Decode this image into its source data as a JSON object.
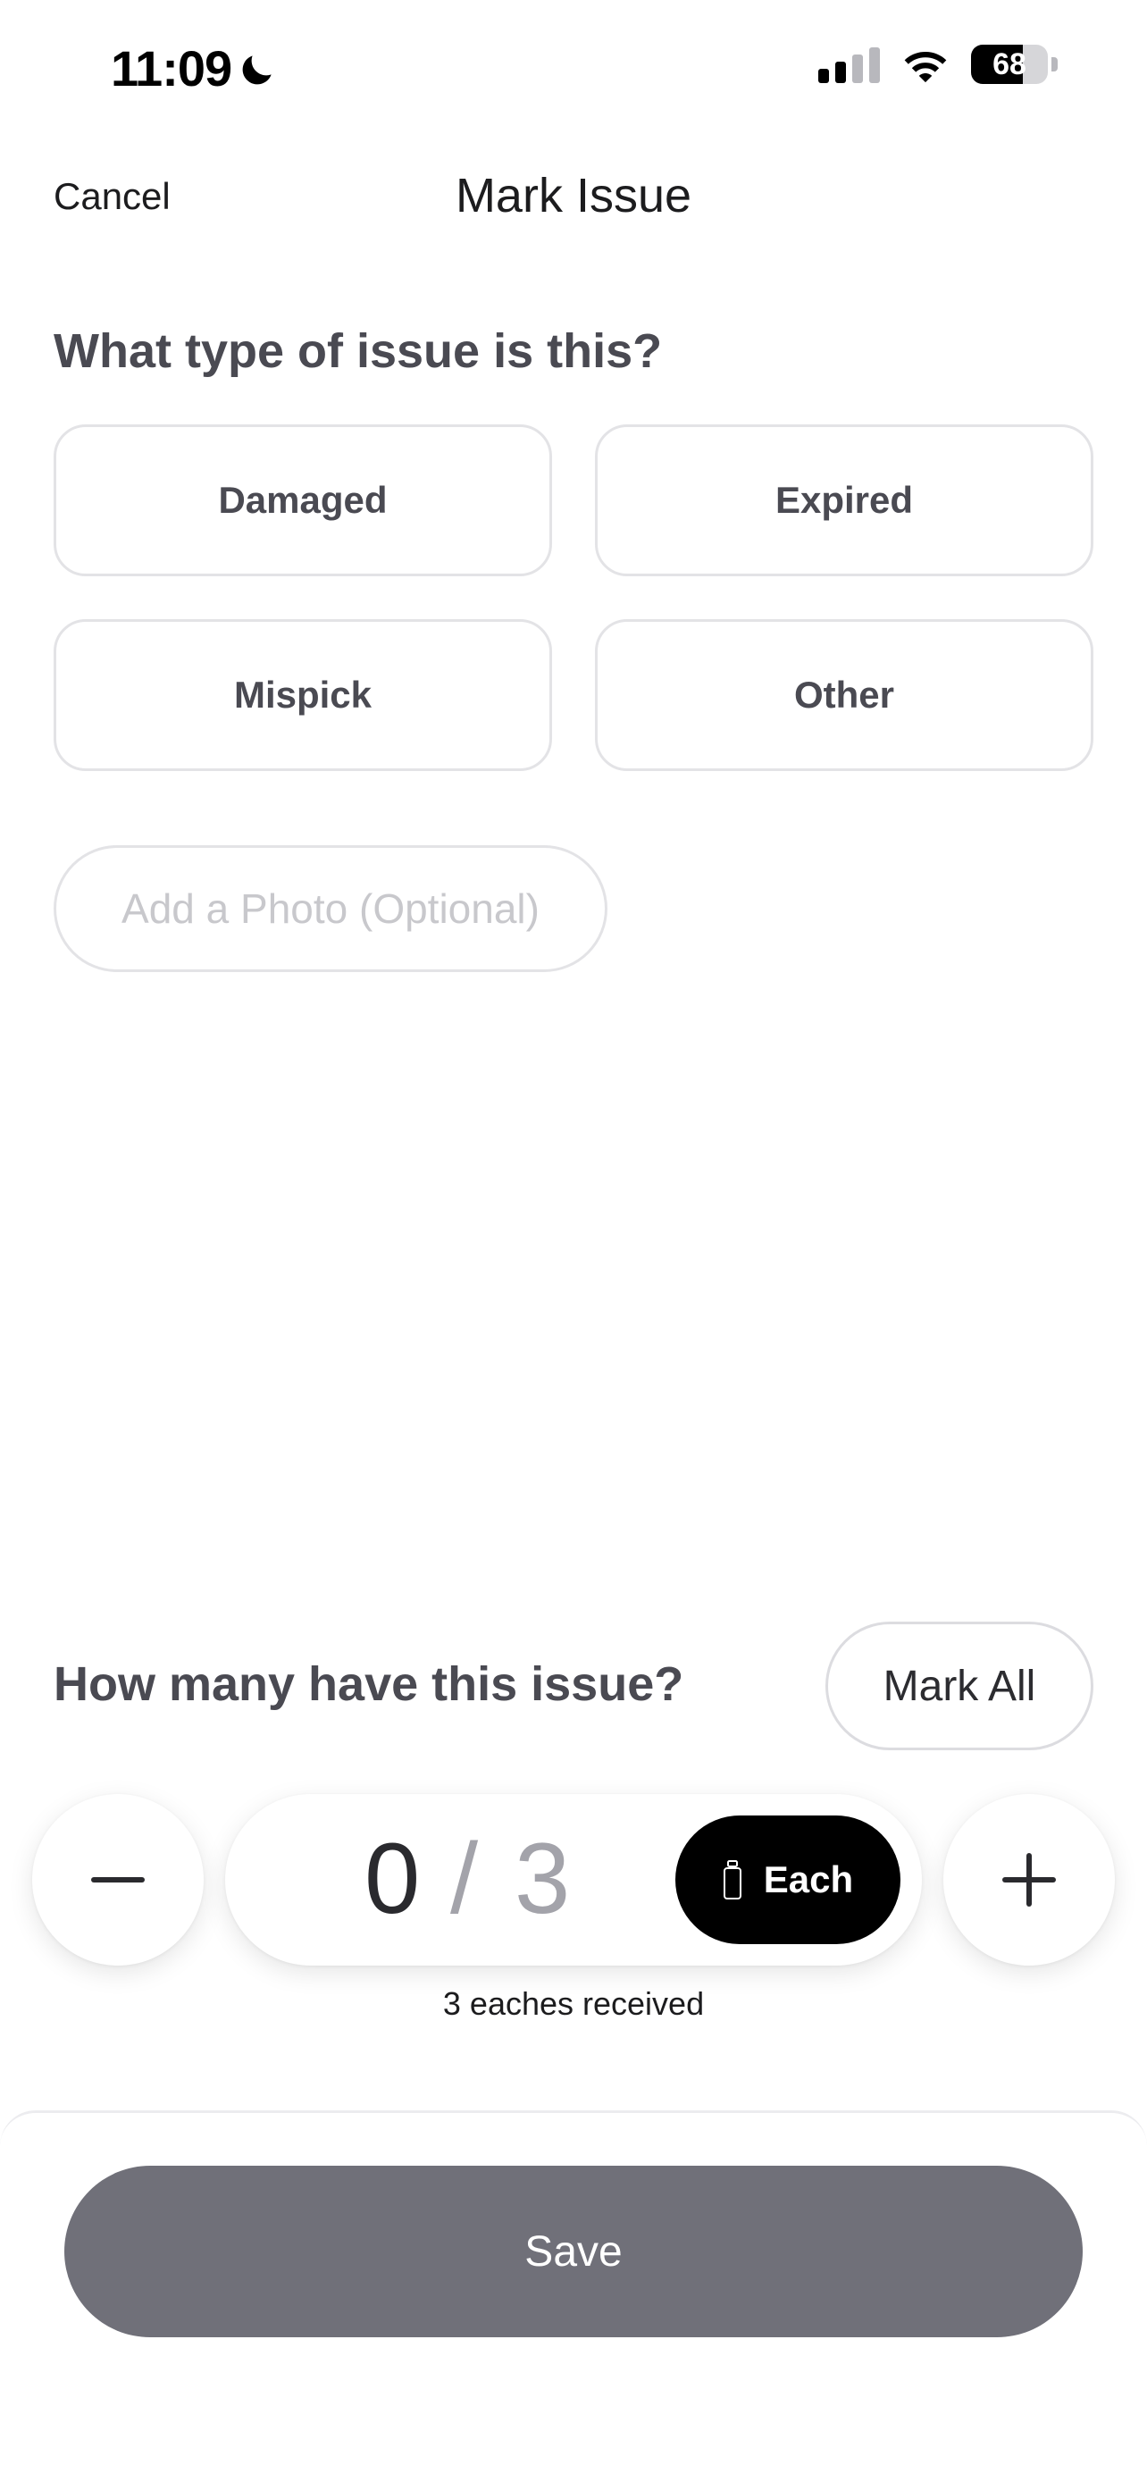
{
  "status_bar": {
    "time": "11:09",
    "battery": "68",
    "battery_level_percent": 68,
    "signal_bars_active": 2,
    "signal_bars_total": 4,
    "icons": [
      "moon-icon",
      "signal-icon",
      "wifi-icon",
      "battery-icon"
    ]
  },
  "nav": {
    "cancel_label": "Cancel",
    "title": "Mark Issue"
  },
  "issue_type": {
    "question": "What type of issue is this?",
    "options": [
      "Damaged",
      "Expired",
      "Mispick",
      "Other"
    ]
  },
  "photo": {
    "label": "Add a Photo (Optional)"
  },
  "quantity": {
    "question": "How many have this issue?",
    "mark_all_label": "Mark All",
    "current": "0",
    "separator": "/",
    "total": "3",
    "unit_label": "Each",
    "received_text": "3 eaches received",
    "icons": [
      "minus-icon",
      "plus-icon",
      "bottle-icon"
    ]
  },
  "footer": {
    "save_label": "Save"
  },
  "colors": {
    "save_button_bg": "#707079",
    "unit_toggle_bg": "#000000",
    "heading_text": "#4a4a52",
    "muted_text": "#a3a3aa",
    "border": "#e3e3e6"
  }
}
